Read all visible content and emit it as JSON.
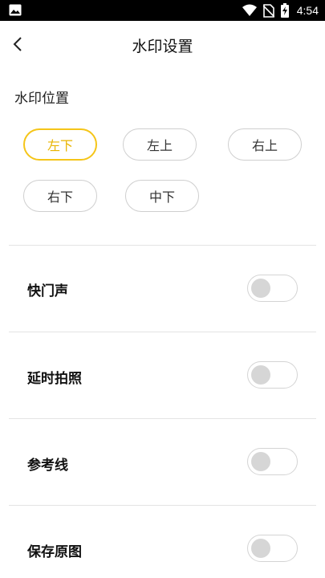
{
  "status_bar": {
    "time": "4:54",
    "icons": [
      "image-icon",
      "wifi-icon",
      "no-sim-icon",
      "battery-charging-icon"
    ]
  },
  "header": {
    "title": "水印设置",
    "back_icon": "chevron-left-icon"
  },
  "watermark_position": {
    "title": "水印位置",
    "selected": "左下",
    "options": [
      "左下",
      "左上",
      "右上",
      "右下",
      "中下"
    ]
  },
  "settings": [
    {
      "label": "快门声",
      "enabled": false
    },
    {
      "label": "延时拍照",
      "enabled": false
    },
    {
      "label": "参考线",
      "enabled": false
    },
    {
      "label": "保存原图",
      "enabled": false
    }
  ],
  "colors": {
    "accent": "#f5c518",
    "accent_text": "#e8b400",
    "border": "#cfcfcf",
    "knob_off": "#d6d6d6"
  }
}
